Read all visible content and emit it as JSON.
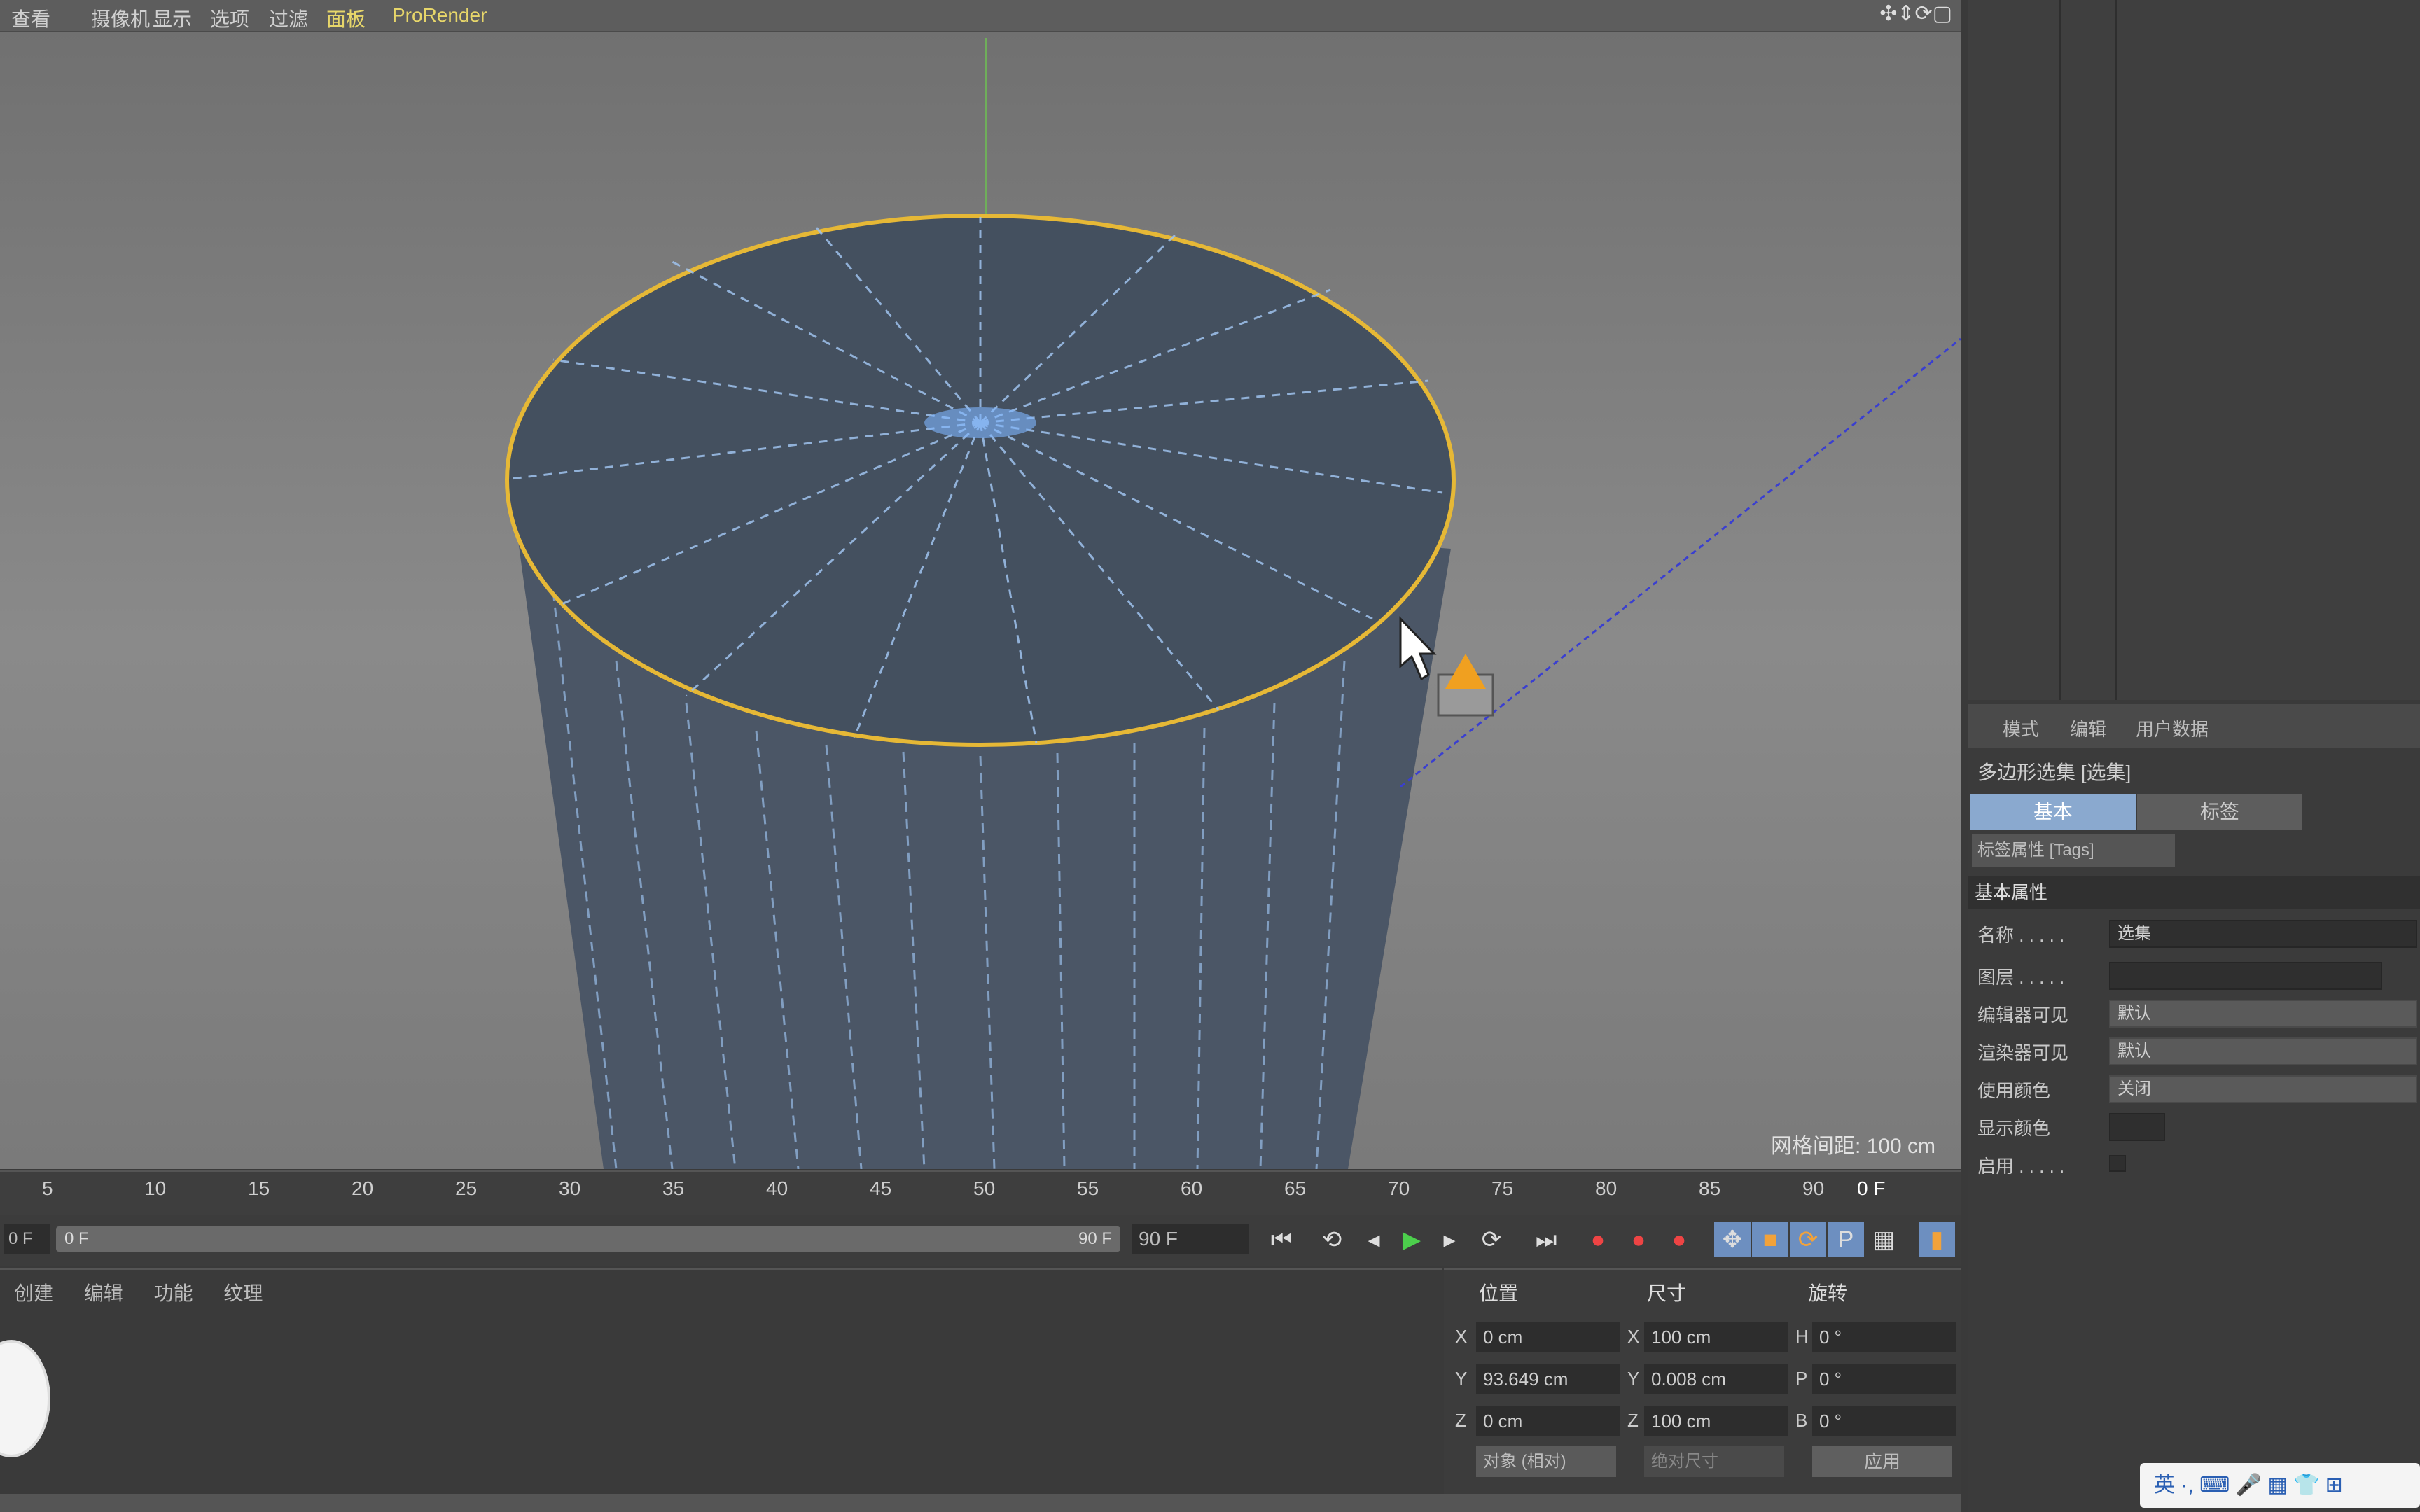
{
  "viewport": {
    "menu": [
      "查看",
      "摄像机",
      "显示",
      "选项",
      "过滤",
      "面板",
      "ProRender"
    ],
    "scale_label": "网格间距",
    "scale_value": ": 100 cm",
    "nav_icons": "✣⇕⟳▢"
  },
  "timeline": {
    "ticks": [
      "5",
      "10",
      "15",
      "20",
      "25",
      "30",
      "35",
      "40",
      "45",
      "50",
      "55",
      "60",
      "65",
      "70",
      "75",
      "80",
      "85",
      "90"
    ],
    "end_frame": "0 F",
    "start_field": "0 F",
    "current_frame": "90 F",
    "scrub_left": "0 F",
    "scrub_right": "90 F"
  },
  "material_panel": {
    "menu": [
      "创建",
      "编辑",
      "功能",
      "纹理"
    ]
  },
  "coordinates": {
    "headers": [
      "位置",
      "尺寸",
      "旋转"
    ],
    "rows": [
      {
        "axis": "X",
        "pos": "0 cm",
        "size_axis": "X",
        "size": "100 cm",
        "rot_axis": "H",
        "rot": "0 °"
      },
      {
        "axis": "Y",
        "pos": "93.649 cm",
        "size_axis": "Y",
        "size": "0.008 cm",
        "rot_axis": "P",
        "rot": "0 °"
      },
      {
        "axis": "Z",
        "pos": "0 cm",
        "size_axis": "Z",
        "size": "100 cm",
        "rot_axis": "B",
        "rot": "0 °"
      }
    ],
    "mode_dropdown": "对象 (相对)",
    "size_dropdown": "绝对尺寸",
    "apply_button": "应用"
  },
  "attributes": {
    "toolbar": [
      "模式",
      "编辑",
      "用户数据"
    ],
    "title": "多边形选集 [选集]",
    "tabs": [
      "基本",
      "标签"
    ],
    "tag_row": "标签属性 [Tags]",
    "section": "基本属性",
    "props": [
      {
        "label": "名称 . . . . .",
        "value": "选集"
      },
      {
        "label": "图层 . . . . .",
        "value": ""
      },
      {
        "label": "编辑器可见",
        "value": "默认"
      },
      {
        "label": "渲染器可见",
        "value": "默认"
      },
      {
        "label": "使用颜色",
        "value": "关闭"
      },
      {
        "label": "显示颜色",
        "value": ""
      },
      {
        "label": "启用 . . . . .",
        "value": ""
      }
    ]
  },
  "taskbar": {
    "text": "英 ·, ⌨ 🎤 ▦ 👕 ⊞"
  },
  "colors": {
    "accent_tab": "#8aa9cf",
    "selection_outline": "#e6b836",
    "mesh": "#4b5666"
  }
}
